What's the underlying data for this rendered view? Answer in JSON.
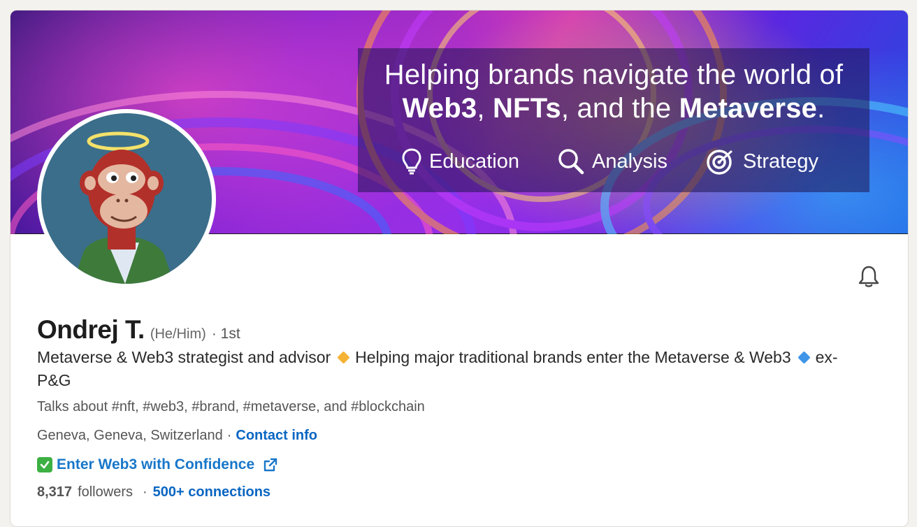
{
  "banner": {
    "line1": "Helping brands navigate the world of",
    "line2_parts": [
      "Web3",
      ", ",
      "NFTs",
      ", and the ",
      "Metaverse",
      "."
    ],
    "pillars": [
      {
        "icon": "lightbulb-icon",
        "label": "Education"
      },
      {
        "icon": "magnifier-icon",
        "label": "Analysis"
      },
      {
        "icon": "target-icon",
        "label": "Strategy"
      }
    ]
  },
  "profile": {
    "name": "Ondrej T.",
    "pronouns": "(He/Him)",
    "degree": "· 1st",
    "headline_part1": "Metaverse & Web3 strategist and advisor",
    "headline_part2": "Helping major traditional brands enter the Metaverse & Web3",
    "headline_part3": "ex-P&G",
    "talks_about": "Talks about #nft, #web3, #brand, #metaverse, and #blockchain",
    "location": "Geneva, Geneva, Switzerland",
    "separator": "·",
    "contact_info_label": "Contact info",
    "website_label": "Enter Web3 with Confidence",
    "followers_count": "8,317",
    "followers_label": "followers",
    "connections_label": "500+ connections"
  },
  "colors": {
    "link_blue": "#0a66c2",
    "website_blue": "#1877c9",
    "check_green": "#3cb043",
    "diamond_orange": "#f5b336",
    "diamond_blue": "#3f96e8"
  }
}
